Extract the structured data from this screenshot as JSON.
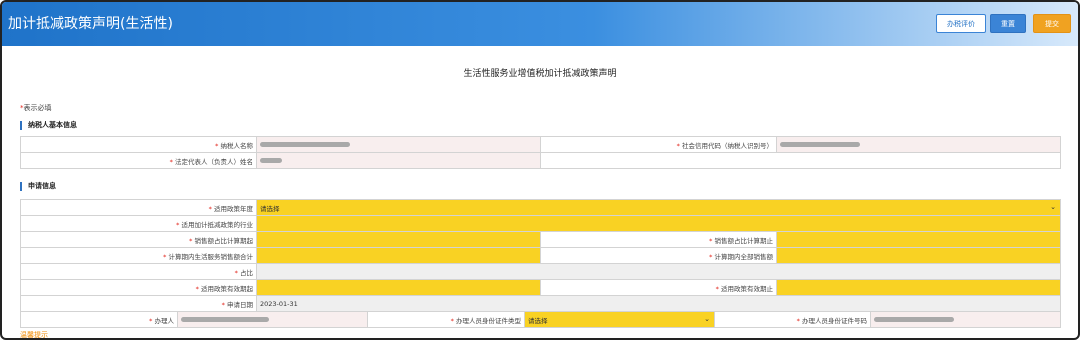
{
  "header": {
    "title": "加计抵减政策声明(生活性)",
    "buttons": {
      "evaluate": "办税评价",
      "reset": "重置",
      "submit": "提交"
    }
  },
  "doc_title": "生活性服务业增值税加计抵减政策声明",
  "required_note": {
    "star": "*",
    "text": "表示必填"
  },
  "sections": {
    "basic": "纳税人基本信息",
    "apply": "申请信息"
  },
  "basic": {
    "taxpayer_name_label": "纳税人名称",
    "credit_code_label": "社会信用代码（纳税人识别号）",
    "legal_rep_label": "法定代表人（负责人）姓名"
  },
  "apply": {
    "policy_year_label": "适用政策年度",
    "policy_year_value": "请选择",
    "industry_label": "适用加计抵减政策的行业",
    "sales_start_label": "销售额占比计算期起",
    "sales_end_label": "销售额占比计算期止",
    "life_sales_label": "计算期内生活服务销售额合计",
    "total_sales_label": "计算期内全部销售额",
    "ratio_label": "占比",
    "valid_start_label": "适用政策有效期起",
    "valid_end_label": "适用政策有效期止",
    "apply_date_label": "申请日期",
    "apply_date_value": "2023-01-31",
    "agent_label": "办理人",
    "agent_id_type_label": "办理人员身份证件类型",
    "agent_id_type_value": "请选择",
    "agent_id_no_label": "办理人员身份证件号码"
  },
  "tips_label": "温馨提示",
  "colors": {
    "header_blue": "#1f73c9",
    "required_yellow": "#f9d223",
    "submit_orange": "#f0a221",
    "star_red": "#e2231a"
  }
}
